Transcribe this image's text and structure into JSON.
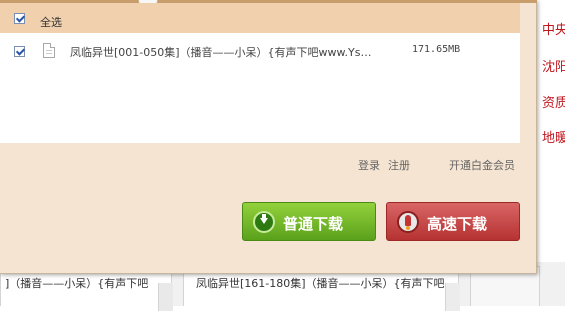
{
  "side_links": [
    "中央",
    "沈阳",
    "资质",
    "地暖"
  ],
  "background_list": [
    {
      "text": "]（播音——小呆）{有声下吧"
    },
    {
      "text": "凤临异世[161-180集]（播音——小呆）{有声下吧"
    }
  ],
  "panel": {
    "select_all_label": "全选",
    "files": [
      {
        "name": "凤临异世[001-050集]（播音——小呆）{有声下吧www.Ys…",
        "size": "171.65MB",
        "checked": true
      }
    ],
    "links": {
      "login": "登录",
      "register": "注册",
      "vip": "开通白金会员"
    },
    "buttons": {
      "normal_download": "普通下载",
      "fast_download": "高速下载"
    }
  },
  "colors": {
    "panel_bg": "#f5e4d1",
    "header_bg": "#f0d0ad",
    "green_button": "#6cb324",
    "red_button": "#c44444",
    "side_link": "#c0161e"
  },
  "icons": {
    "file": "file-icon",
    "download": "download-arrow-icon",
    "rocket": "rocket-icon",
    "checkbox": "checkbox-checked-icon"
  }
}
